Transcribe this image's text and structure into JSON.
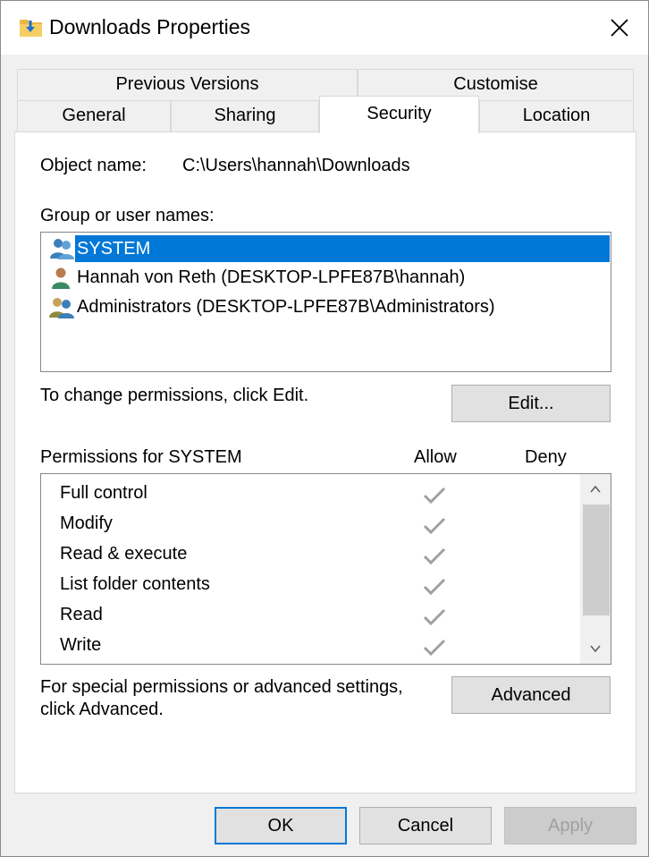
{
  "window": {
    "title": "Downloads Properties",
    "folder_icon": "folder-downloads-icon",
    "close_icon": "close-icon"
  },
  "tabs": {
    "row1": [
      {
        "label": "Previous Versions"
      },
      {
        "label": "Customise"
      }
    ],
    "row2": [
      {
        "label": "General"
      },
      {
        "label": "Sharing"
      },
      {
        "label": "Security",
        "active": true
      },
      {
        "label": "Location"
      }
    ]
  },
  "security": {
    "object_name_label": "Object name:",
    "object_name_value": "C:\\Users\\hannah\\Downloads",
    "group_label": "Group or user names:",
    "users": [
      {
        "name": "SYSTEM",
        "icon": "user-group-icon",
        "selected": true
      },
      {
        "name": "Hannah von Reth (DESKTOP-LPFE87B\\hannah)",
        "icon": "user-icon",
        "selected": false
      },
      {
        "name": "Administrators (DESKTOP-LPFE87B\\Administrators)",
        "icon": "admin-group-icon",
        "selected": false
      }
    ],
    "change_text": "To change permissions, click Edit.",
    "edit_button": "Edit...",
    "permissions_for": "Permissions for SYSTEM",
    "allow_header": "Allow",
    "deny_header": "Deny",
    "permissions": [
      {
        "name": "Full control",
        "allow": true,
        "deny": false
      },
      {
        "name": "Modify",
        "allow": true,
        "deny": false
      },
      {
        "name": "Read & execute",
        "allow": true,
        "deny": false
      },
      {
        "name": "List folder contents",
        "allow": true,
        "deny": false
      },
      {
        "name": "Read",
        "allow": true,
        "deny": false
      },
      {
        "name": "Write",
        "allow": true,
        "deny": false
      }
    ],
    "advanced_text_1": "For special permissions or advanced settings,",
    "advanced_text_2": "click Advanced.",
    "advanced_button": "Advanced"
  },
  "footer": {
    "ok": "OK",
    "cancel": "Cancel",
    "apply": "Apply"
  },
  "colors": {
    "selection": "#0078d7",
    "check": "#a0a0a0"
  }
}
